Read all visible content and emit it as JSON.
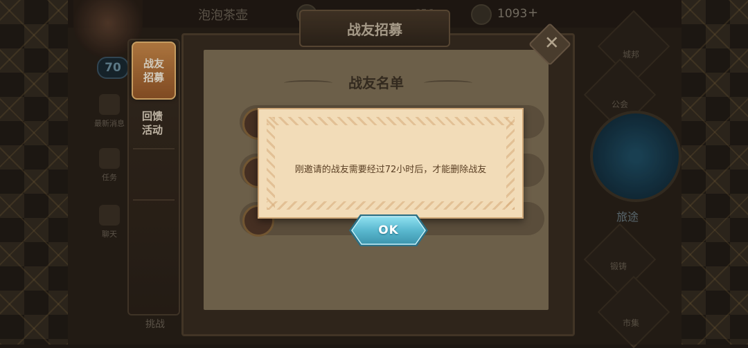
{
  "player": {
    "name": "泡泡茶壶",
    "level": "70"
  },
  "currency": {
    "coins": "656",
    "gems": "1093",
    "plus": "+"
  },
  "header": {
    "title": "战友招募"
  },
  "left_menu": [
    {
      "label": "最新消息"
    },
    {
      "label": "任务"
    },
    {
      "label": "聊天"
    }
  ],
  "tabs": [
    {
      "label": "战友招募",
      "active": true
    },
    {
      "label": "回馈活动",
      "active": false
    }
  ],
  "panel": {
    "list_title": "战友名单"
  },
  "right_menu": [
    {
      "label": "城邦"
    },
    {
      "label": "公会"
    },
    {
      "label": "旅途"
    },
    {
      "label": "锻铸"
    },
    {
      "label": "市集"
    }
  ],
  "bottom_left": {
    "label": "挑战"
  },
  "dialog": {
    "message": "刚邀请的战友需要经过72小时后，才能删除战友",
    "ok_label": "OK"
  },
  "colors": {
    "dialog_bg": "#f2dcb8",
    "ok_button": "#5ab8cf",
    "active_tab": "#c98545"
  }
}
